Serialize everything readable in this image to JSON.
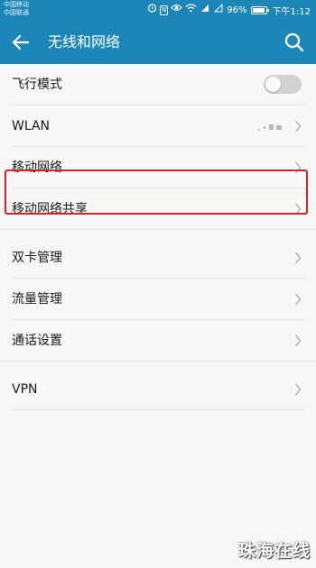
{
  "status_bar": {
    "carrier_1": "中国移动",
    "carrier_2": "中国联通",
    "battery_text": "96%",
    "battery_level": 0.96,
    "time": "下午1:12",
    "icons": [
      "alarm-icon",
      "nfc-icon",
      "eye-icon",
      "wifi-icon",
      "signal-4g-icon",
      "signal-icon",
      "battery-icon"
    ]
  },
  "header": {
    "title": "无线和网络",
    "back_icon": "arrow-left-icon",
    "search_icon": "search-icon",
    "background": "#1d86b8"
  },
  "settings": {
    "items": [
      {
        "label": "飞行模式",
        "control": "toggle",
        "toggle_on": false
      },
      {
        "label": "WLAN",
        "control": "chevron"
      },
      {
        "label": "移动网络",
        "control": "chevron"
      },
      {
        "label": "移动网络共享",
        "control": "chevron"
      },
      {
        "label": "双卡管理",
        "control": "chevron",
        "highlighted": true
      },
      {
        "label": "流量管理",
        "control": "chevron"
      },
      {
        "label": "通话设置",
        "control": "chevron"
      },
      {
        "label": "VPN",
        "control": "chevron"
      }
    ]
  },
  "annotation": {
    "highlight_color": "#d8222a"
  },
  "watermark": {
    "text": "珠海在线"
  }
}
